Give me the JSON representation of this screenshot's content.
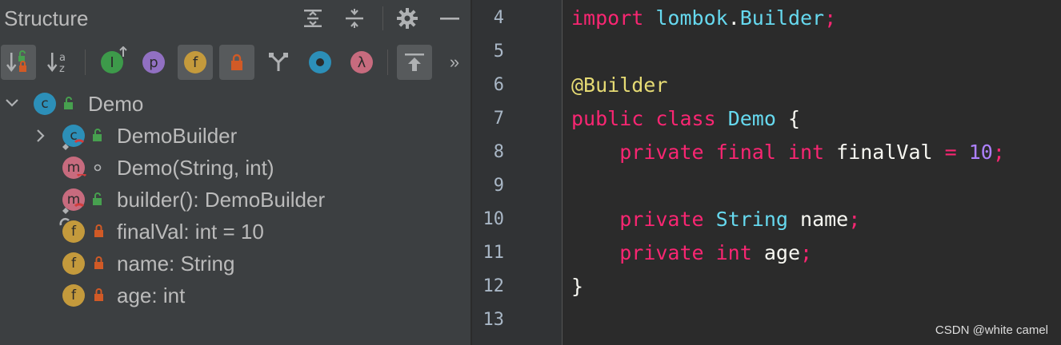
{
  "panel": {
    "title": "Structure",
    "toolbar_more": "»"
  },
  "icons": {
    "expand_all": "expand-all-icon",
    "collapse_all": "collapse-all-icon",
    "settings": "gear-icon",
    "hide": "minimize-icon",
    "sort_visibility": "sort-by-visibility-icon",
    "sort_alpha": "sort-alphabetically-icon",
    "show_inherited": "show-inherited-icon",
    "show_properties": "show-properties-icon",
    "show_fields": "show-fields-icon",
    "show_non_public": "show-non-public-icon",
    "show_anonymous": "anonymous-classes-icon",
    "show_lambdas": "lambdas-icon",
    "autoscroll": "autoscroll-from-source-icon"
  },
  "toolbar_glyphs": {
    "inherited": "I",
    "properties": "p",
    "fields": "f",
    "lambda": "λ",
    "sort_alpha_a": "a",
    "sort_alpha_z": "z"
  },
  "tree": [
    {
      "label": "Demo",
      "kind_glyph": "c",
      "kind": "class"
    },
    {
      "label": "DemoBuilder",
      "kind_glyph": "c",
      "kind": "class"
    },
    {
      "label": "Demo(String, int)",
      "kind_glyph": "m",
      "kind": "method"
    },
    {
      "label": "builder(): DemoBuilder",
      "kind_glyph": "m",
      "kind": "method"
    },
    {
      "label": "finalVal: int = 10",
      "kind_glyph": "f",
      "kind": "field"
    },
    {
      "label": "name: String",
      "kind_glyph": "f",
      "kind": "field"
    },
    {
      "label": "age: int",
      "kind_glyph": "f",
      "kind": "field"
    }
  ],
  "colors": {
    "class": "#2c8fb8",
    "method": "#c76b7e",
    "field": "#c49a3c",
    "inherited": "#3d9a4a",
    "property": "#9170c2",
    "lock_private": "#d15a26",
    "lock_public": "#47a04f",
    "anonymous": "#2c8fb8",
    "lambda": "#c76b7e"
  },
  "editor": {
    "line_numbers": [
      "4",
      "5",
      "6",
      "7",
      "8",
      "9",
      "10",
      "11",
      "12",
      "13"
    ],
    "code": {
      "l4_kw": "import",
      "l4_pkg": "lombok",
      "l4_dot": ".",
      "l4_cls": "Builder",
      "l4_semi": ";",
      "l6_ann": "@Builder",
      "l7_kw": "public class",
      "l7_name": "Demo",
      "l7_brace": " {",
      "l8_kw": "private final int",
      "l8_name": "finalVal",
      "l8_eq": " = ",
      "l8_num": "10",
      "l8_semi": ";",
      "l10_kw": "private",
      "l10_type": "String",
      "l10_name": "name",
      "l10_semi": ";",
      "l11_kw": "private int",
      "l11_name": "age",
      "l11_semi": ";",
      "l12_close": "}"
    }
  },
  "watermark": "CSDN @white camel"
}
